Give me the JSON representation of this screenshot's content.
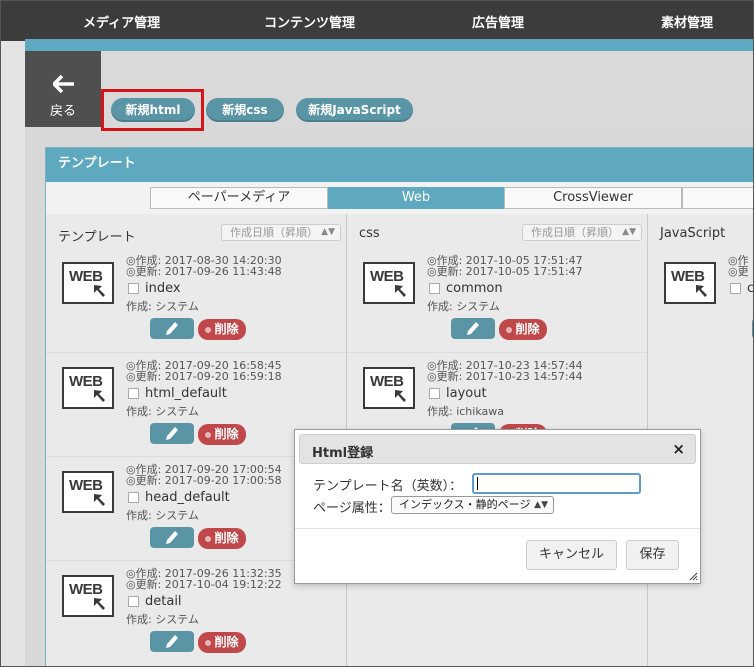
{
  "nav": {
    "items": [
      "メディア管理",
      "コンテンツ管理",
      "広告管理",
      "素材管理"
    ]
  },
  "back": {
    "label": "戻る",
    "icon": "arrow-left-icon"
  },
  "actions": {
    "new_html": "新規html",
    "new_css": "新規css",
    "new_js": "新規JavaScript"
  },
  "panel": {
    "title": "テンプレート",
    "tabs": [
      "ペーパーメディア",
      "Web",
      "CrossViewer"
    ],
    "active_tab": "Web"
  },
  "columns": [
    {
      "title": "テンプレート",
      "sort": "作成日順（昇順）",
      "cards": [
        {
          "created": "◎作成: 2017-08-30 14:20:30",
          "updated": "◎更新: 2017-09-26 11:43:48",
          "name": "index",
          "creator": "作成: システム",
          "delete": "削除"
        },
        {
          "created": "◎作成: 2017-09-20 16:58:45",
          "updated": "◎更新: 2017-09-20 16:59:18",
          "name": "html_default",
          "creator": "作成: システム",
          "delete": "削除"
        },
        {
          "created": "◎作成: 2017-09-20 17:00:54",
          "updated": "◎更新: 2017-09-20 17:00:58",
          "name": "head_default",
          "creator": "作成: システム",
          "delete": "削除"
        },
        {
          "created": "◎作成: 2017-09-26 11:32:35",
          "updated": "◎更新: 2017-10-04 19:12:22",
          "name": "detail",
          "creator": "作成: システム",
          "delete": "削除"
        }
      ]
    },
    {
      "title": "css",
      "sort": "作成日順（昇順）",
      "cards": [
        {
          "created": "◎作成: 2017-10-05 17:51:47",
          "updated": "◎更新: 2017-10-05 17:51:47",
          "name": "common",
          "creator": "作成: システム",
          "delete": "削除"
        },
        {
          "created": "◎作成: 2017-10-23 14:57:44",
          "updated": "◎更新: 2017-10-23 14:57:44",
          "name": "layout",
          "creator": "作成: ichikawa",
          "delete": "削除"
        }
      ]
    },
    {
      "title": "JavaScript",
      "cards": [
        {
          "created": "◎作",
          "updated": "◎更",
          "name": "co"
        }
      ]
    }
  ],
  "modal": {
    "title": "Html登録",
    "close": "×",
    "name_label": "テンプレート名（英数）：",
    "name_value": "",
    "attr_label": "ページ属性：",
    "attr_value": "インデックス・静的ページ",
    "cancel": "キャンセル",
    "save": "保存"
  },
  "colors": {
    "teal": "#5ea9c0",
    "pill": "#5a95a6",
    "delete": "#c0474a",
    "highlight": "#d5141c",
    "navbar": "#3c3c3c"
  }
}
